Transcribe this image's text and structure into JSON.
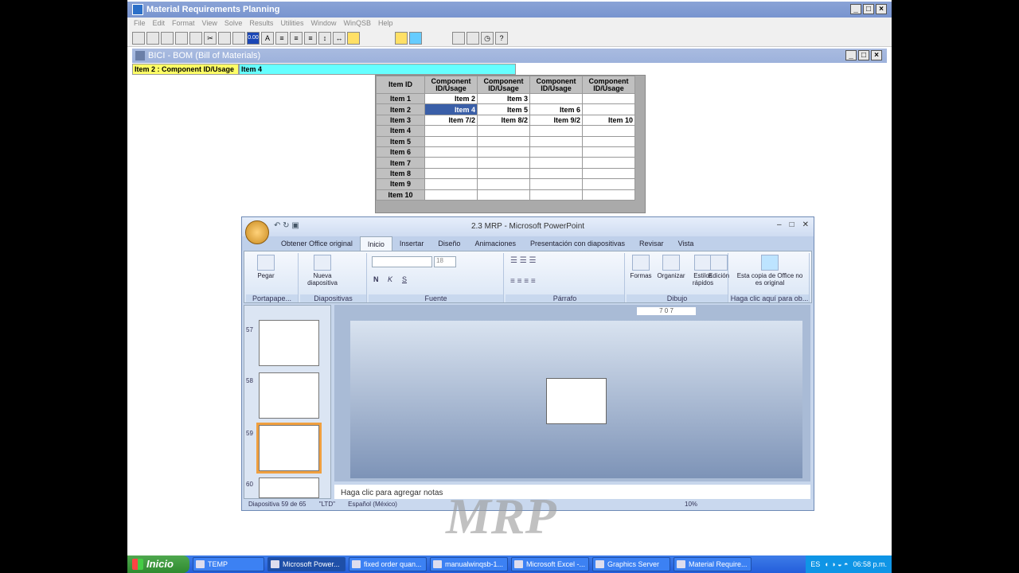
{
  "winqsb": {
    "title": "Material Requirements Planning",
    "menu": [
      "File",
      "Edit",
      "Format",
      "View",
      "Solve",
      "Results",
      "Utilities",
      "Window",
      "WinQSB",
      "Help"
    ],
    "fixed_label": "0.00"
  },
  "bom": {
    "title": "BICI - BOM (Bill of Materials)",
    "cell_label": "Item 2 : Component ID/Usage",
    "cell_value": "Item 4",
    "headers": [
      "Item ID",
      "Component ID/Usage",
      "Component ID/Usage",
      "Component ID/Usage",
      "Component ID/Usage"
    ],
    "rows": [
      {
        "id": "Item 1",
        "c": [
          "Item 2",
          "Item 3",
          "",
          ""
        ]
      },
      {
        "id": "Item 2",
        "c": [
          "Item 4",
          "Item 5",
          "Item 6",
          ""
        ]
      },
      {
        "id": "Item 3",
        "c": [
          "Item 7/2",
          "Item 8/2",
          "Item 9/2",
          "Item 10"
        ]
      },
      {
        "id": "Item 4",
        "c": [
          "",
          "",
          "",
          ""
        ]
      },
      {
        "id": "Item 5",
        "c": [
          "",
          "",
          "",
          ""
        ]
      },
      {
        "id": "Item 6",
        "c": [
          "",
          "",
          "",
          ""
        ]
      },
      {
        "id": "Item 7",
        "c": [
          "",
          "",
          "",
          ""
        ]
      },
      {
        "id": "Item 8",
        "c": [
          "",
          "",
          "",
          ""
        ]
      },
      {
        "id": "Item 9",
        "c": [
          "",
          "",
          "",
          ""
        ]
      },
      {
        "id": "Item 10",
        "c": [
          "",
          "",
          "",
          ""
        ]
      }
    ]
  },
  "ppt": {
    "title": "2.3 MRP - Microsoft PowerPoint",
    "tabs": [
      "Obtener Office original",
      "Inicio",
      "Insertar",
      "Diseño",
      "Animaciones",
      "Presentación con diapositivas",
      "Revisar",
      "Vista"
    ],
    "active_tab": "Inicio",
    "groups": {
      "portapapeles": "Portapape...",
      "diapositivas": "Diapositivas",
      "fuente": "Fuente",
      "parrafo": "Párrafo",
      "dibujo": "Dibujo",
      "office": "Haga clic aquí para ob..."
    },
    "buttons": {
      "pegar": "Pegar",
      "nueva": "Nueva diapositiva",
      "formas": "Formas",
      "organizar": "Organizar",
      "estilos": "Estilos rápidos",
      "edicion": "Edición",
      "copia": "Esta copia de Office no es original"
    },
    "font_size": "18",
    "slides": [
      "57",
      "58",
      "59",
      "60"
    ],
    "ruler": "7   0   7",
    "notes": "Haga clic para agregar notas",
    "status": {
      "slide": "Diapositiva 59 de 65",
      "theme": "\"LTD\"",
      "lang": "Español (México)",
      "zoom": "10%"
    }
  },
  "watermark": "MRP",
  "taskbar": {
    "start": "Inicio",
    "tasks": [
      "TEMP",
      "Microsoft Power...",
      "fixed order quan...",
      "manualwinqsb-1...",
      "Microsoft Excel -...",
      "Graphics Server",
      "Material Require..."
    ],
    "active": 1,
    "lang": "ES",
    "time": "06:58 p.m."
  }
}
